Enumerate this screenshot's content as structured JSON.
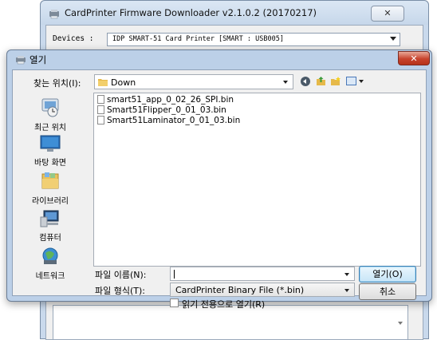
{
  "background_window": {
    "title": "CardPrinter Firmware Downloader v2.1.0.2 (20170217)",
    "close_label": "✕",
    "devices_label": "Devices :",
    "devices_value": "IDP SMART-51 Card Printer  [SMART : USB005]"
  },
  "dialog": {
    "title": "열기",
    "close_label": "✕",
    "look_in_label": "찾는 위치(I):",
    "look_in_value": "Down",
    "places": [
      {
        "label": "최근 위치"
      },
      {
        "label": "바탕 화면"
      },
      {
        "label": "라이브러리"
      },
      {
        "label": "컴퓨터"
      },
      {
        "label": "네트워크"
      }
    ],
    "files": [
      {
        "name": "smart51_app_0_02_26_SPI.bin"
      },
      {
        "name": "Smart51Flipper_0_01_03.bin"
      },
      {
        "name": "Smart51Laminator_0_01_03.bin"
      }
    ],
    "file_name_label": "파일 이름(N):",
    "file_name_value": "",
    "file_type_label": "파일 형식(T):",
    "file_type_value": "CardPrinter Binary File (*.bin)",
    "readonly_label": "읽기 전용으로 열기(R)",
    "open_button": "열기(O)",
    "cancel_button": "취소"
  }
}
